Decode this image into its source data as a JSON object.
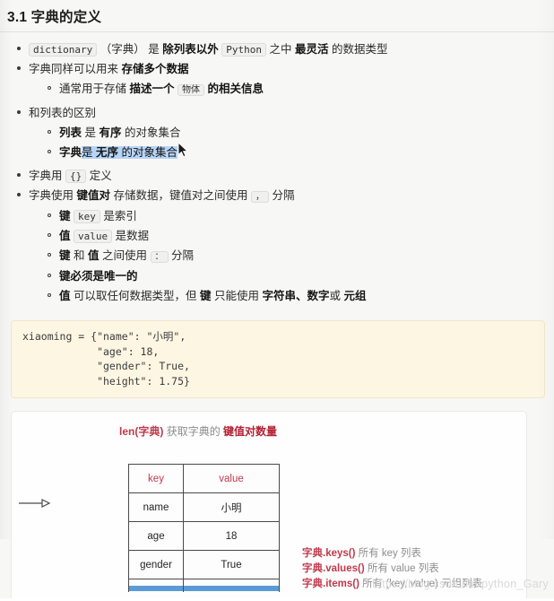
{
  "heading": "3.1 字典的定义",
  "bullets": {
    "b1": {
      "code": "dictionary",
      "t1": "（字典）",
      "t2": "是",
      "b1": "除列表以外",
      "code2": "Python",
      "t3": "之中",
      "b2": "最灵活",
      "t4": "的数据类型"
    },
    "b2": {
      "t1": "字典同样可以用来",
      "b1": "存储多个数据"
    },
    "b2_sub": {
      "t1": "通常用于存储",
      "b1": "描述一个",
      "code": "物体",
      "b2": "的相关信息"
    },
    "b3": {
      "t1": "和列表的区别"
    },
    "b3_sub1": {
      "b1": "列表",
      "t1": "是",
      "b2": "有序",
      "t2": "的对象集合"
    },
    "b3_sub2": {
      "b1": "字典",
      "t1": "是",
      "b2": "无序",
      "t2": "的对象集合"
    },
    "b4": {
      "t1": "字典用",
      "code": "{}",
      "t2": "定义"
    },
    "b5": {
      "t1": "字典使用",
      "b1": "键值对",
      "t2": "存储数据，键值对之间使用",
      "code": "，",
      "t3": "分隔"
    },
    "b5_sub1": {
      "b1": "键",
      "code": "key",
      "t1": "是索引"
    },
    "b5_sub2": {
      "b1": "值",
      "code": "value",
      "t1": "是数据"
    },
    "b5_sub3": {
      "b1": "键",
      "t1": "和",
      "b2": "值",
      "t2": "之间使用",
      "code": "：",
      "t3": "分隔"
    },
    "b5_sub4": {
      "b1": "键必须是唯一的"
    },
    "b5_sub5": {
      "b1": "值",
      "t1": "可以取任何数据类型，但",
      "b2": "键",
      "t2": "只能使用",
      "b3": "字符串、数字",
      "t3": "或",
      "b4": "元组"
    }
  },
  "code_block": "xiaoming = {\"name\": \"小明\",\n            \"age\": 18,\n            \"gender\": True,\n            \"height\": 1.75}",
  "figure": {
    "caption": {
      "fn": "len(字典)",
      "mid": "获取字典的",
      "emph": "键值对数量"
    },
    "table": {
      "headers": [
        "key",
        "value"
      ],
      "rows": [
        [
          "name",
          "小明"
        ],
        [
          "age",
          "18"
        ],
        [
          "gender",
          "True"
        ]
      ]
    },
    "annotations": [
      {
        "method": "字典.keys()",
        "desc": "所有 key 列表"
      },
      {
        "method": "字典.values()",
        "desc": "所有 value 列表"
      },
      {
        "method": "字典.items()",
        "desc": "所有 (key, value) 元组列表"
      }
    ]
  },
  "watermark": "https://blog.csdn.net/python_Gary",
  "colors": {
    "page_bg": "#f7f7f5",
    "heading": "#1d1d1d",
    "accent_red": "#c0394b",
    "emph_red": "#b22234",
    "selection_blue": "#b6d4f5",
    "code_bg": "#fdf6e3",
    "chip_bg": "#f0f0ee",
    "watermark": "#d9d9d9"
  }
}
